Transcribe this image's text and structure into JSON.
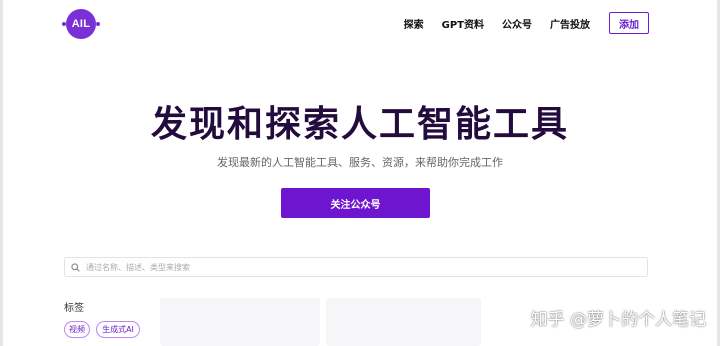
{
  "header": {
    "logo_text": "AIL",
    "nav": [
      "探索",
      "GPT资料",
      "公众号",
      "广告投放"
    ],
    "add_button": "添加"
  },
  "hero": {
    "title": "发现和探索人工智能工具",
    "subtitle": "发现最新的人工智能工具、服务、资源，来帮助你完成工作",
    "cta": "关注公众号"
  },
  "search": {
    "placeholder": "通过名称、描述、类型来搜索",
    "value": ""
  },
  "tags": {
    "heading": "标签",
    "items": [
      "视频",
      "生成式AI"
    ]
  },
  "watermark": "知乎 @萝卜的个人笔记",
  "colors": {
    "accent": "#6e16cf",
    "title": "#240b3d"
  }
}
